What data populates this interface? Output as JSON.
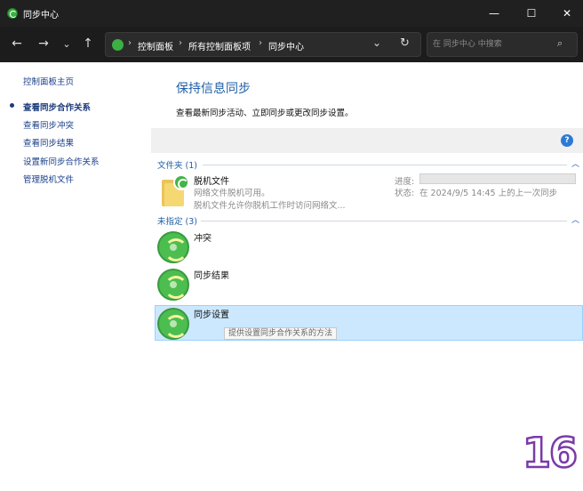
{
  "window": {
    "title": "同步中心",
    "minimize_glyph": "—",
    "maximize_glyph": "☐",
    "close_glyph": "✕"
  },
  "navigation": {
    "back_glyph": "←",
    "forward_glyph": "→",
    "recent_glyph": "⌄",
    "up_glyph": "↑",
    "breadcrumbs": [
      "控制面板",
      "所有控制面板项",
      "同步中心"
    ],
    "separator": "›",
    "dropdown_glyph": "⌄",
    "refresh_glyph": "↻",
    "search_placeholder": "在 同步中心 中搜索",
    "search_icon_glyph": "⌕"
  },
  "sidebar": {
    "items": [
      {
        "label": "控制面板主页"
      },
      {
        "label": "查看同步合作关系",
        "active": true
      },
      {
        "label": "查看同步冲突"
      },
      {
        "label": "查看同步结果"
      },
      {
        "label": "设置新同步合作关系"
      },
      {
        "label": "管理脱机文件"
      }
    ]
  },
  "main": {
    "title": "保持信息同步",
    "description": "查看最新同步活动、立即同步或更改同步设置。",
    "help_glyph": "?",
    "groups": [
      {
        "header": "文件夹 (1)",
        "collapse_glyph": "︿",
        "items": [
          {
            "title": "脱机文件",
            "line1": "网络文件脱机可用。",
            "line2": "脱机文件允许你脱机工作时访问网络文...",
            "progress_label": "进度:",
            "progress_value": 0,
            "status_label": "状态:",
            "status_text": "在 2024/9/5 14:45 上的上一次同步"
          }
        ]
      },
      {
        "header": "未指定 (3)",
        "collapse_glyph": "︿",
        "items": [
          {
            "title": "冲突"
          },
          {
            "title": "同步结果"
          },
          {
            "title": "同步设置",
            "selected": true,
            "tooltip": "提供设置同步合作关系的方法"
          }
        ]
      }
    ]
  },
  "overlay": {
    "corner_number": "16"
  },
  "colors": {
    "accent_blue": "#1f5fa6",
    "selection": "#cce8ff",
    "sync_green": "#4bbe4f",
    "dark_chrome": "#202020"
  }
}
